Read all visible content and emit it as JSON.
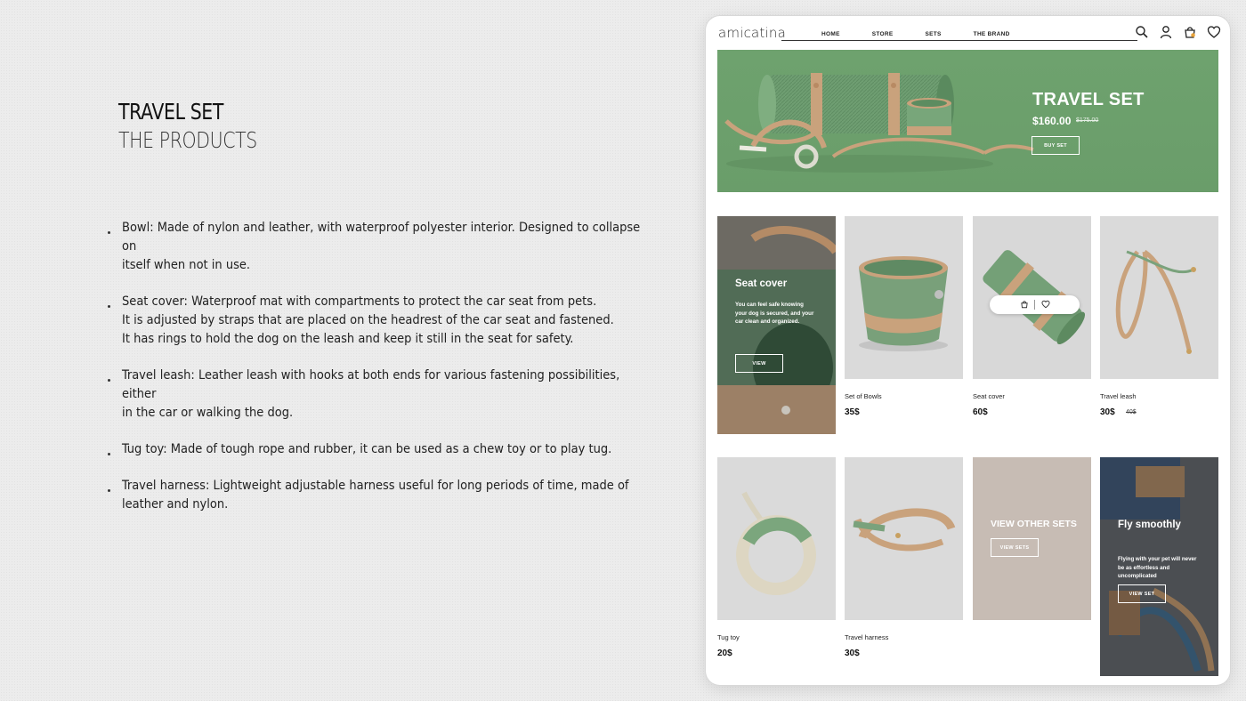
{
  "heading": {
    "title": "TRAVEL SET",
    "subtitle": "THE PRODUCTS"
  },
  "descriptions": [
    {
      "lines": [
        "Bowl: Made of nylon and leather, with waterproof polyester interior. Designed to collapse on",
        "itself when not in use."
      ]
    },
    {
      "lines": [
        "Seat cover: Waterproof mat with compartments to protect the car seat from pets.",
        "It is adjusted by straps that are placed on the headrest of the car seat and fastened.",
        "It has rings to hold the dog on the leash and keep it still in the seat for safety."
      ]
    },
    {
      "lines": [
        "Travel leash: Leather leash with hooks at both ends for various fastening possibilities, either",
        "in the car or walking the dog."
      ]
    },
    {
      "lines": [
        "Tug toy: Made of tough rope and rubber, it can be used as a chew toy or to play tug."
      ]
    },
    {
      "lines": [
        "Travel harness: Lightweight adjustable harness useful for long periods of time, made of",
        "leather and nylon."
      ]
    }
  ],
  "site": {
    "logo": "amicatina",
    "nav": [
      "HOME",
      "STORE",
      "SETS",
      "THE BRAND"
    ],
    "icons": [
      "search-icon",
      "user-icon",
      "cart-icon",
      "heart-icon"
    ],
    "accent": "#6ea26e"
  },
  "hero": {
    "title": "TRAVEL SET",
    "price": "$160.00",
    "old_price": "$175.00",
    "button": "BUY SET"
  },
  "promo_seat": {
    "title": "Seat cover",
    "text": "You can feel safe knowing your dog is secured, and your car clean and organized.",
    "button": "VIEW"
  },
  "products_row1": [
    {
      "name": "Set of Bowls",
      "price": "35$"
    },
    {
      "name": "Seat cover",
      "price": "60$"
    },
    {
      "name": "Travel leash",
      "price": "30$",
      "old_price": "40$"
    }
  ],
  "products_row2": [
    {
      "name": "Tug toy",
      "price": "20$"
    },
    {
      "name": "Travel harness",
      "price": "30$"
    }
  ],
  "promo_sets": {
    "title": "VIEW OTHER SETS",
    "button": "VIEW SETS"
  },
  "promo_fly": {
    "title": "Fly smoothly",
    "text": "Flying with your pet will never be as effortless and uncomplicated",
    "button": "VIEW SET"
  }
}
